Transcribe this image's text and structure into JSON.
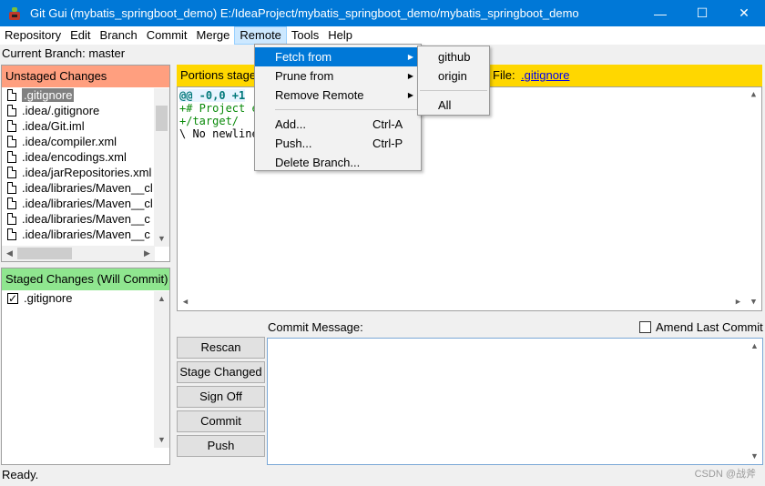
{
  "window": {
    "title": "Git Gui (mybatis_springboot_demo) E:/IdeaProject/mybatis_springboot_demo/mybatis_springboot_demo",
    "minimize": "—",
    "maximize": "☐",
    "close": "✕"
  },
  "menubar": [
    "Repository",
    "Edit",
    "Branch",
    "Commit",
    "Merge",
    "Remote",
    "Tools",
    "Help"
  ],
  "current_branch": "Current Branch: master",
  "unstaged": {
    "title": "Unstaged Changes",
    "files": [
      ".gitignore",
      ".idea/.gitignore",
      ".idea/Git.iml",
      ".idea/compiler.xml",
      ".idea/encodings.xml",
      ".idea/jarRepositories.xml",
      ".idea/libraries/Maven__cl",
      ".idea/libraries/Maven__cl",
      ".idea/libraries/Maven__c",
      ".idea/libraries/Maven__c"
    ]
  },
  "staged": {
    "title": "Staged Changes (Will Commit)",
    "files": [
      ".gitignore"
    ]
  },
  "diff": {
    "header": "Portions staged",
    "file_label": "File:",
    "file_name": ".gitignore",
    "lines": [
      "@@ -0,0 +1",
      "+# Project e",
      "+/target/",
      "\\ No newline"
    ]
  },
  "commit": {
    "message_label": "Commit Message:",
    "amend_label": "Amend Last Commit",
    "buttons": [
      "Rescan",
      "Stage Changed",
      "Sign Off",
      "Commit",
      "Push"
    ]
  },
  "status": "Ready.",
  "watermark": "CSDN @战斧",
  "remote_menu": {
    "items": [
      {
        "label": "Fetch from",
        "submenu": "▶"
      },
      {
        "label": "Prune from",
        "submenu": "▶"
      },
      {
        "label": "Remove Remote",
        "submenu": "▶"
      }
    ],
    "items2": [
      {
        "label": "Add...",
        "accel": "Ctrl-A"
      },
      {
        "label": "Push...",
        "accel": "Ctrl-P"
      },
      {
        "label": "Delete Branch...",
        "accel": ""
      }
    ]
  },
  "fetch_submenu": [
    "github",
    "origin",
    "All"
  ]
}
